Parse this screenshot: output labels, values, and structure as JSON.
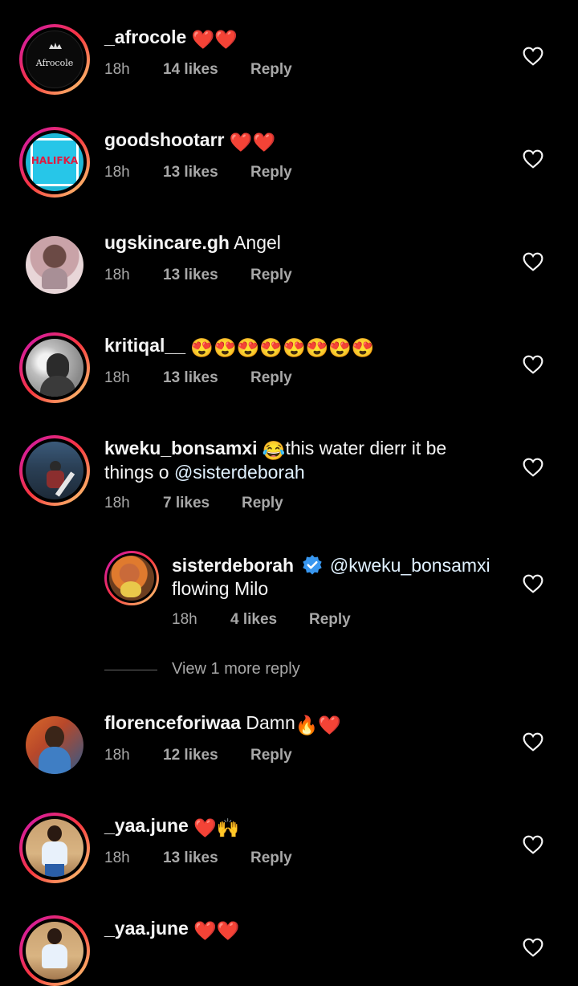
{
  "comments": [
    {
      "username": "_afrocole",
      "text": "",
      "emojis": "❤️❤️",
      "time": "18h",
      "likes": "14 likes",
      "reply": "Reply",
      "avatar_text": "Afrocole"
    },
    {
      "username": "goodshootarr",
      "text": "",
      "emojis": "❤️❤️",
      "time": "18h",
      "likes": "13 likes",
      "reply": "Reply",
      "avatar_text": "HALIFKA"
    },
    {
      "username": "ugskincare.gh",
      "text": "Angel",
      "emojis": "",
      "time": "18h",
      "likes": "13 likes",
      "reply": "Reply"
    },
    {
      "username": "kritiqal__",
      "text": "",
      "emojis": "😍😍😍😍😍😍😍😍",
      "time": "18h",
      "likes": "13 likes",
      "reply": "Reply"
    },
    {
      "username": "kweku_bonsamxi",
      "emojis": "😂",
      "text": "this water dierr it be",
      "text2": "things o",
      "mention": "@sisterdeborah",
      "time": "18h",
      "likes": "7 likes",
      "reply": "Reply"
    },
    {
      "username": "sisterdeborah",
      "mention": "@kweku_bonsamxi",
      "text2": "flowing Milo",
      "time": "18h",
      "likes": "4 likes",
      "reply": "Reply",
      "verified": true
    },
    {
      "username": "florenceforiwaa",
      "text": "Damn",
      "emojis": "🔥❤️",
      "time": "18h",
      "likes": "12 likes",
      "reply": "Reply"
    },
    {
      "username": "_yaa.june",
      "text": "",
      "emojis": "❤️🙌",
      "time": "18h",
      "likes": "13 likes",
      "reply": "Reply"
    },
    {
      "username": "_yaa.june",
      "text": "",
      "emojis": "❤️❤️"
    }
  ],
  "view_more_replies": "View 1 more reply",
  "colors": {
    "background": "#000000",
    "text": "#f5f5f5",
    "secondary": "#a8a8a8",
    "verified": "#3897f0",
    "mention": "#e0f1ff"
  },
  "icons": {
    "like": "heart-outline-icon",
    "verified": "verified-badge-icon"
  }
}
